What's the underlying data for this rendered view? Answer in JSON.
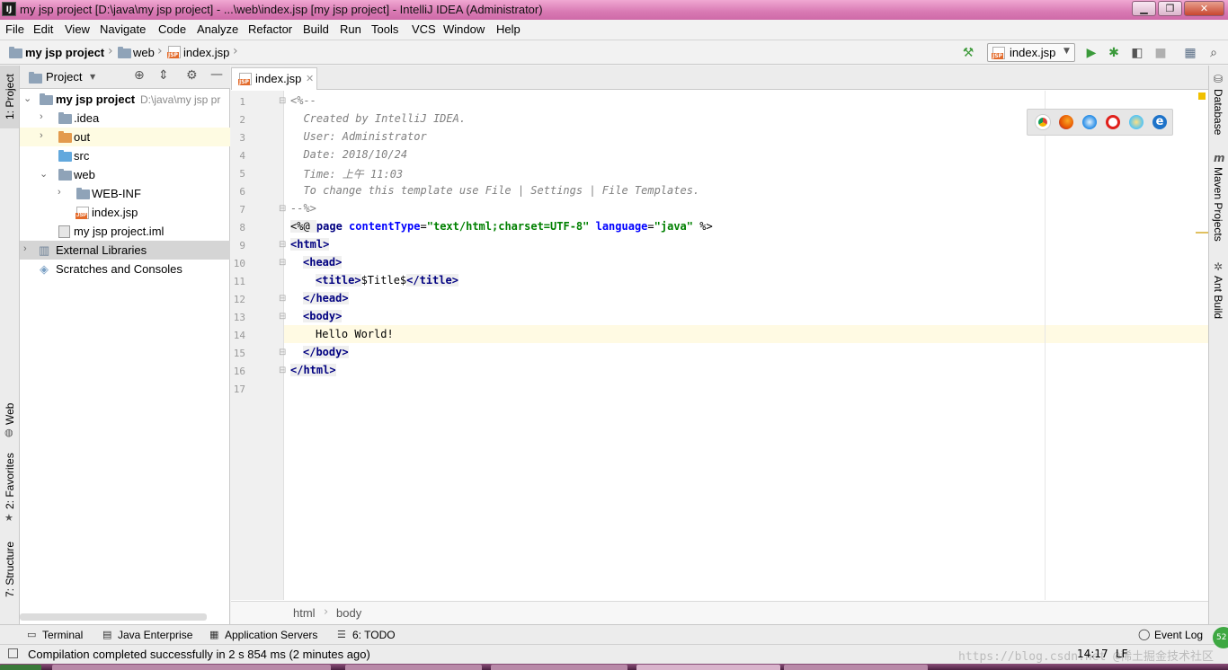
{
  "window": {
    "title": "my jsp project [D:\\java\\my jsp project] - ...\\web\\index.jsp [my jsp project] - IntelliJ IDEA (Administrator)",
    "logo_text": "IJ"
  },
  "menu": [
    "File",
    "Edit",
    "View",
    "Navigate",
    "Code",
    "Analyze",
    "Refactor",
    "Build",
    "Run",
    "Tools",
    "VCS",
    "Window",
    "Help"
  ],
  "navbar": {
    "crumbs": [
      "my jsp project",
      "web",
      "index.jsp"
    ],
    "run_config": "index.jsp"
  },
  "left_strip": {
    "project_tab": "1: Project",
    "web_tab": "Web",
    "favorites_tab": "2: Favorites",
    "structure_tab": "7: Structure"
  },
  "right_strip": {
    "database_tab": "Database",
    "maven_tab": "Maven Projects",
    "ant_tab": "Ant Build"
  },
  "project_panel": {
    "title": "Project",
    "tree": [
      {
        "label": "my jsp project",
        "path": "D:\\java\\my jsp pr"
      },
      {
        "label": ".idea"
      },
      {
        "label": "out"
      },
      {
        "label": "src"
      },
      {
        "label": "web"
      },
      {
        "label": "WEB-INF"
      },
      {
        "label": "index.jsp"
      },
      {
        "label": "my jsp project.iml"
      },
      {
        "label": "External Libraries"
      },
      {
        "label": "Scratches and Consoles"
      }
    ]
  },
  "editor": {
    "tab_label": "index.jsp",
    "lines": [
      "1",
      "2",
      "3",
      "4",
      "5",
      "6",
      "7",
      "8",
      "9",
      "10",
      "11",
      "12",
      "13",
      "14",
      "15",
      "16",
      "17"
    ],
    "code": {
      "l1": "<%--",
      "l2": "  Created by IntelliJ IDEA.",
      "l3": "  User: Administrator",
      "l4": "  Date: 2018/10/24",
      "l5": "  Time: 上午 11:03",
      "l6": "  To change this template use File | Settings | File Templates.",
      "l7": "--%>",
      "l8_dir_open": "<%@ ",
      "l8_page": "page ",
      "l8_attr1": "contentType",
      "l8_eq1": "=",
      "l8_val1": "\"text/html;charset=UTF-8\"",
      "l8_attr2": " language",
      "l8_eq2": "=",
      "l8_val2": "\"java\"",
      "l8_close": " %>",
      "l9": "<html>",
      "l10": "<head>",
      "l11_open": "<title>",
      "l11_text": "$Title$",
      "l11_close": "</title>",
      "l12": "</head>",
      "l13": "<body>",
      "l14": "Hello World!",
      "l15": "</body>",
      "l16": "</html>"
    },
    "breadcrumb": [
      "html",
      "body"
    ]
  },
  "bottom_tabs": [
    "Terminal",
    "Java Enterprise",
    "Application Servers",
    "6: TODO"
  ],
  "event_log": "Event Log",
  "status": {
    "message": "Compilation completed successfully in 2 s 854 ms (2 minutes ago)",
    "position": "14:17",
    "line_sep": "LF",
    "watermark": "https://blog.csdn.net @稀土掘金技术社区"
  },
  "colors": {
    "titlebar": "#d879b3",
    "current_line": "#fffae3",
    "comment": "#808080",
    "tag": "#000080",
    "string": "#008000"
  }
}
